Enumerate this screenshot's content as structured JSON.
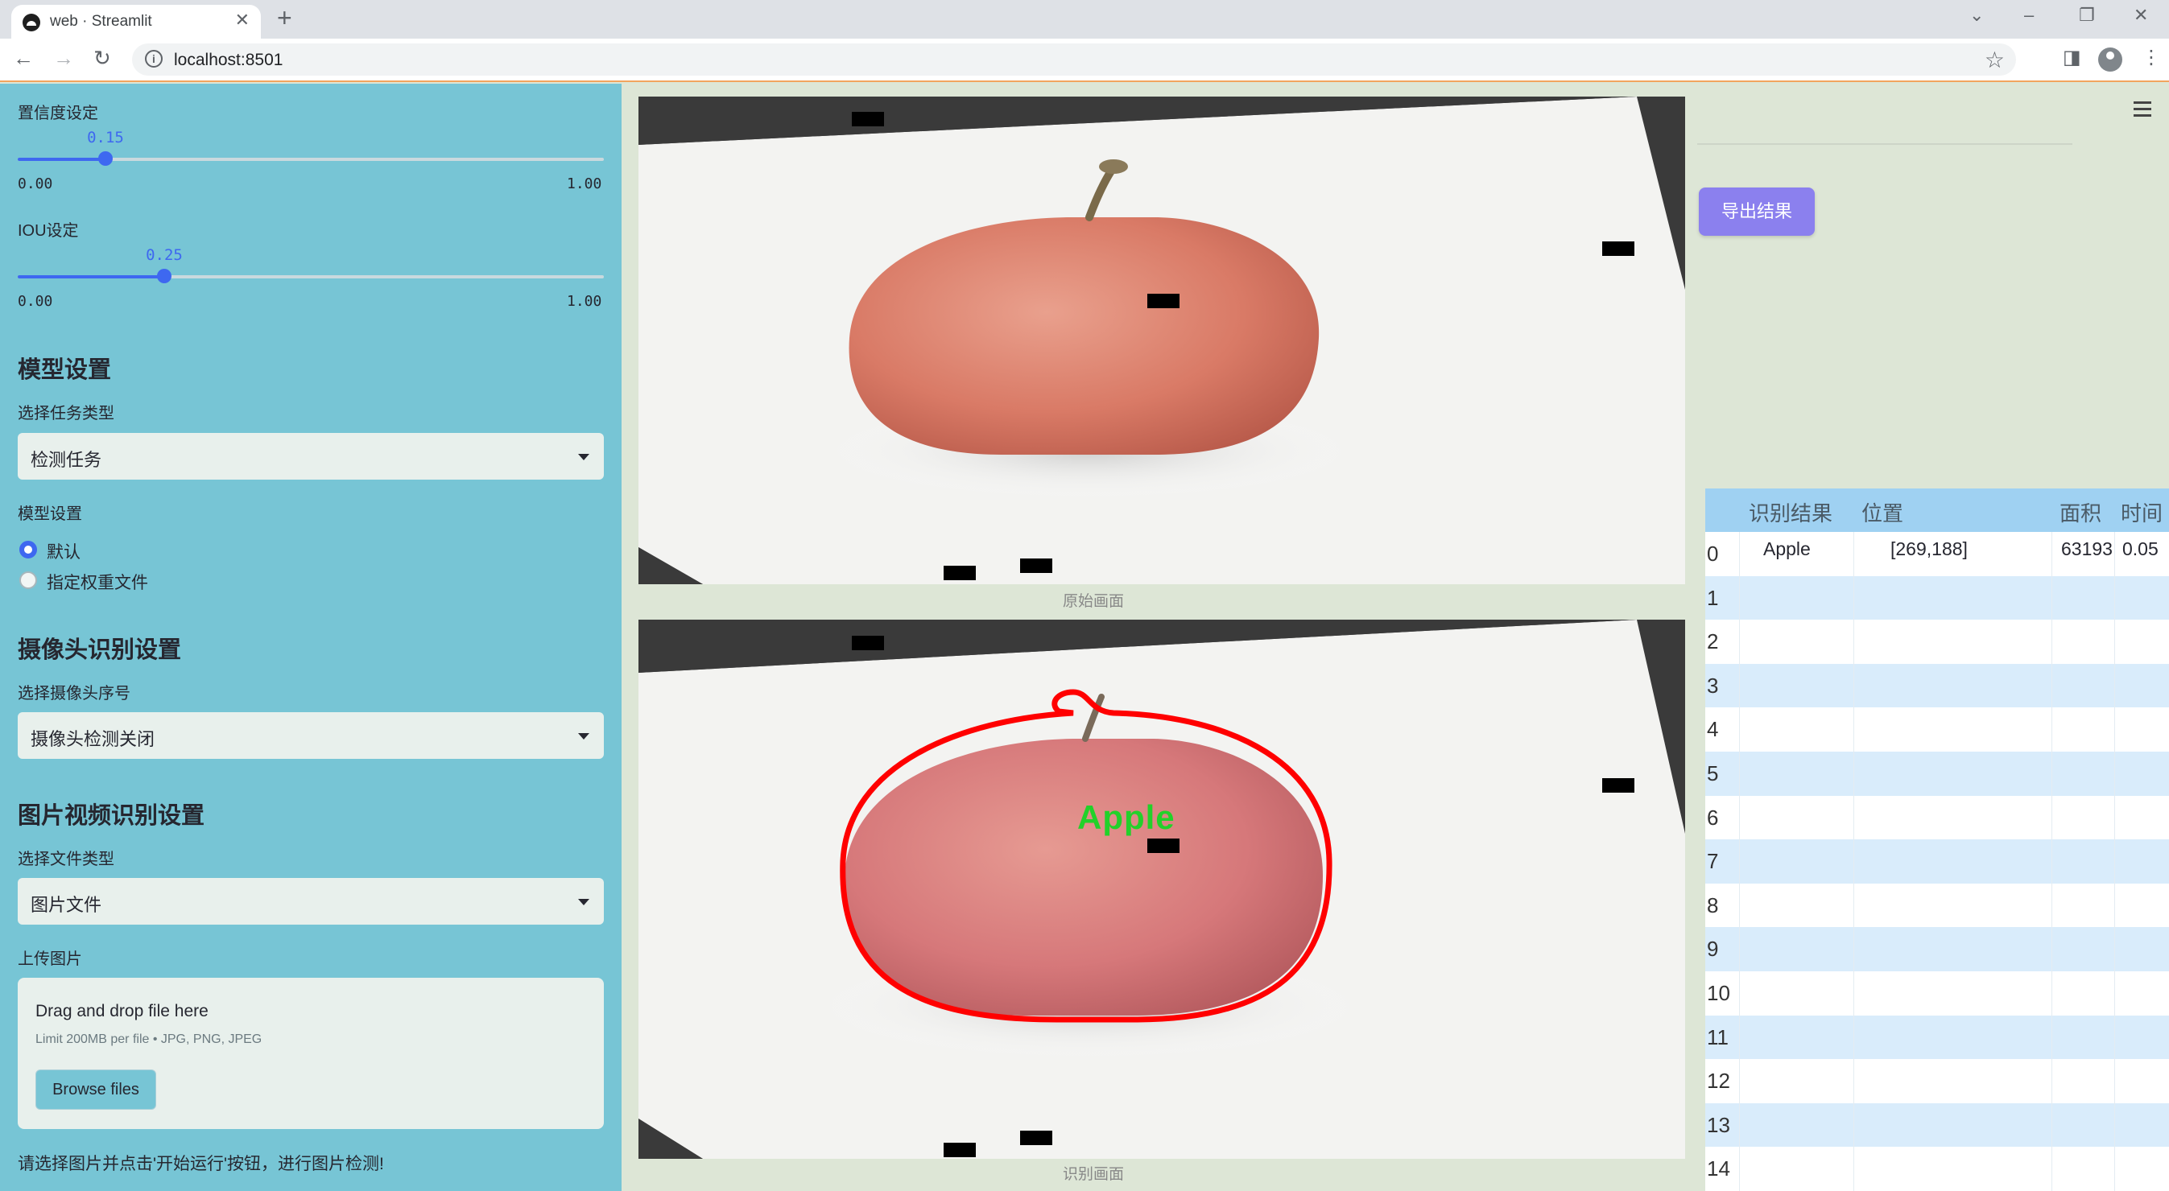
{
  "browser": {
    "tab_title": "web · Streamlit",
    "url": "localhost:8501"
  },
  "sidebar": {
    "confidence": {
      "label": "置信度设定",
      "value": "0.15",
      "fraction": 0.15,
      "min": "0.00",
      "max": "1.00"
    },
    "iou": {
      "label": "IOU设定",
      "value": "0.25",
      "fraction": 0.25,
      "min": "0.00",
      "max": "1.00"
    },
    "model_section": {
      "title": "模型设置",
      "task_label": "选择任务类型",
      "task_value": "检测任务",
      "model_label": "模型设置",
      "options": [
        "默认",
        "指定权重文件"
      ],
      "selected_option": "默认"
    },
    "camera_section": {
      "title": "摄像头识别设置",
      "camera_label": "选择摄像头序号",
      "camera_value": "摄像头检测关闭"
    },
    "media_section": {
      "title": "图片视频识别设置",
      "file_type_label": "选择文件类型",
      "file_type_value": "图片文件",
      "upload_label": "上传图片",
      "dropzone_title": "Drag and drop file here",
      "dropzone_limit": "Limit 200MB per file • JPG, PNG, JPEG",
      "browse_label": "Browse files"
    },
    "hint": "请选择图片并点击'开始运行'按钮，进行图片检测!"
  },
  "main": {
    "original_caption": "原始画面",
    "detected_caption": "识别画面",
    "detection_label": "Apple",
    "colors": {
      "detection_outline": "#ff0000",
      "detection_label": "#22d12a"
    }
  },
  "right": {
    "export_label": "导出结果",
    "table": {
      "headers": [
        "识别结果",
        "位置",
        "面积",
        "时间"
      ],
      "rows": [
        {
          "idx": "0",
          "result": "Apple",
          "position": "[269,188]",
          "area": "63193",
          "time": "0.05"
        },
        {
          "idx": "1"
        },
        {
          "idx": "2"
        },
        {
          "idx": "3"
        },
        {
          "idx": "4"
        },
        {
          "idx": "5"
        },
        {
          "idx": "6"
        },
        {
          "idx": "7"
        },
        {
          "idx": "8"
        },
        {
          "idx": "9"
        },
        {
          "idx": "10"
        },
        {
          "idx": "11"
        },
        {
          "idx": "12"
        },
        {
          "idx": "13"
        },
        {
          "idx": "14"
        }
      ]
    }
  }
}
